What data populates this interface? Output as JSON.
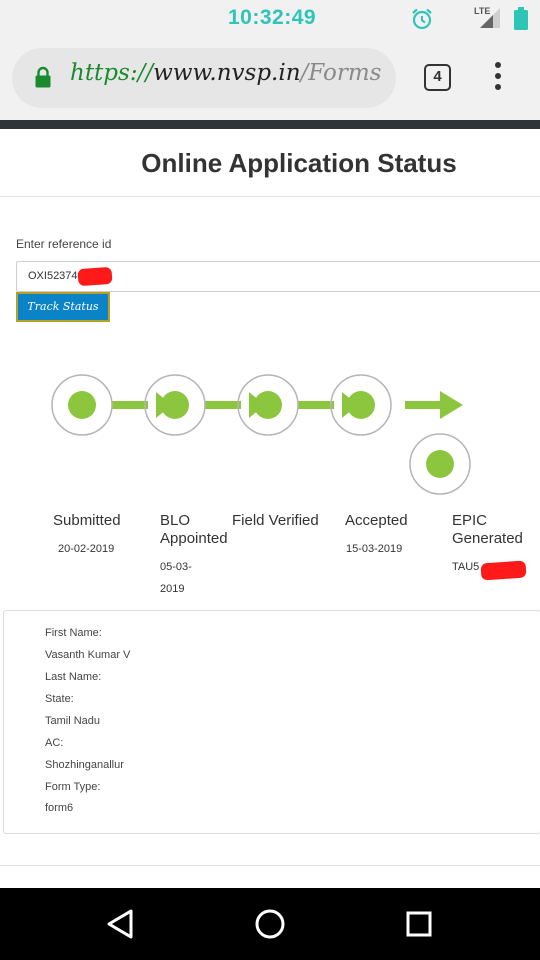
{
  "status_bar": {
    "time": "10:32:49",
    "network_label": "LTE",
    "icons": [
      "alarm-icon",
      "signal-icon",
      "battery-icon"
    ]
  },
  "browser": {
    "url_scheme": "https://",
    "url_host": "www.nvsp.in",
    "url_path": "/Forms",
    "tab_count": "4",
    "icons": [
      "lock-icon",
      "tabs-icon",
      "overflow-menu-icon"
    ],
    "secure_color": "#1a8a2e"
  },
  "page": {
    "title": "Online Application Status",
    "reference": {
      "label": "Enter reference id",
      "value": "OXI52374"
    },
    "track_button_label": "Track Status",
    "accent_color": "#8cc63f",
    "button_color": "#0a84c6"
  },
  "tracker": {
    "steps": [
      {
        "label": "Submitted",
        "date": "20-02-2019"
      },
      {
        "label": "BLO Appointed",
        "date": "05-03-2019"
      },
      {
        "label": "Field Verified",
        "date": ""
      },
      {
        "label": "Accepted",
        "date": "15-03-2019"
      },
      {
        "label": "EPIC Generated",
        "date": "TAU5"
      }
    ]
  },
  "details": {
    "first_name_label": "First Name:",
    "first_name_value": "Vasanth Kumar V",
    "last_name_label": "Last Name:",
    "last_name_value": "",
    "state_label": "State:",
    "state_value": "Tamil Nadu",
    "ac_label": "AC:",
    "ac_value": "Shozhinganallur",
    "form_type_label": "Form Type:",
    "form_type_value": "form6"
  },
  "nav": {
    "icons": [
      "back-icon",
      "home-icon",
      "recents-icon"
    ]
  }
}
